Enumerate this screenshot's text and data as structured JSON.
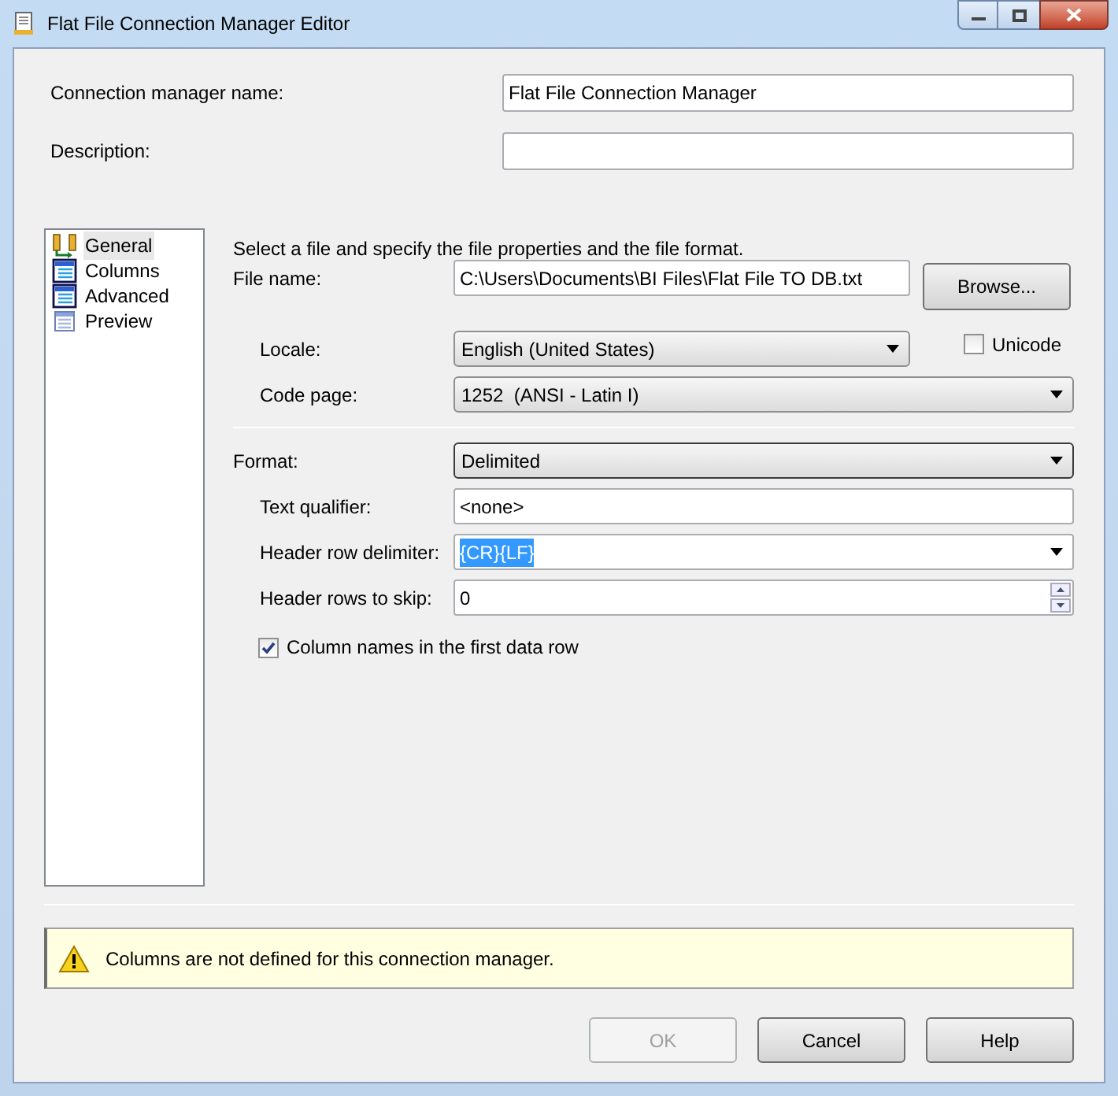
{
  "window": {
    "title": "Flat File Connection Manager Editor"
  },
  "connection_name": {
    "label": "Connection manager name:",
    "value": "Flat File Connection Manager"
  },
  "description": {
    "label": "Description:"
  },
  "sidebar": {
    "items": [
      {
        "label": "General",
        "kind": "general",
        "selected": true
      },
      {
        "label": "Columns",
        "kind": "table",
        "selected": false
      },
      {
        "label": "Advanced",
        "kind": "table",
        "selected": false
      },
      {
        "label": "Preview",
        "kind": "preview",
        "selected": false
      }
    ]
  },
  "panel": {
    "instruction": "Select a file and specify the file properties and the file format.",
    "file_name": {
      "label": "File name:",
      "value": "C:\\Users\\Documents\\BI Files\\Flat File TO DB.txt",
      "button": "Browse..."
    },
    "locale": {
      "label": "Locale:",
      "value": "English (United States)"
    },
    "unicode": {
      "label": "Unicode",
      "checked": false
    },
    "code_page": {
      "label": "Code page:",
      "value": "1252  (ANSI - Latin I)"
    },
    "format": {
      "label": "Format:",
      "value": "Delimited"
    },
    "text_qualifier": {
      "label": "Text qualifier:",
      "value": "<none>"
    },
    "header_row_delimiter": {
      "label": "Header row delimiter:",
      "value": "{CR}{LF}",
      "highlighted": true
    },
    "header_rows_to_skip": {
      "label": "Header rows to skip:",
      "value": "0"
    },
    "column_names": {
      "label": "Column names in the first data row",
      "checked": true
    }
  },
  "warning": {
    "message": "Columns are not defined for this connection manager."
  },
  "buttons": [
    {
      "label": "OK",
      "disabled": true
    },
    {
      "label": "Cancel",
      "disabled": false
    },
    {
      "label": "Help",
      "disabled": false
    }
  ]
}
